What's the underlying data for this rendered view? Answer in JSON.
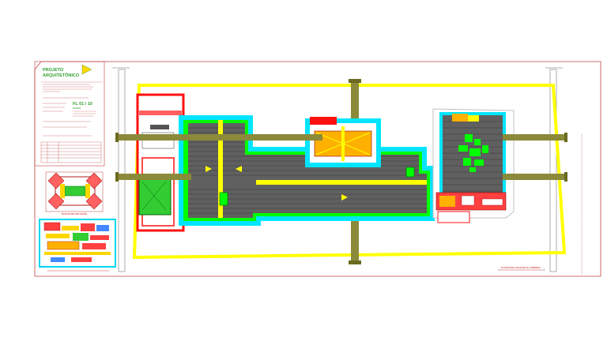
{
  "title_block": {
    "project_title_line1": "PROJETO",
    "project_title_line2": "ARQUITETÔNICO",
    "sheet_number": "FL 01 / 10",
    "sheet_sub": "BANDE"
  },
  "labels": {
    "situation_plan": "PLANTA DE SITUAÇÃO",
    "location_plan": "PLANTA DE LOCAÇÃO E COBERTA"
  },
  "colors": {
    "sheet_border": "#c04040",
    "yellow": "#ffff00",
    "cyan": "#00e5ff",
    "green": "#00ff00",
    "red": "#ff1010",
    "dark_gray": "#555555",
    "olive": "#8a8a3a"
  }
}
